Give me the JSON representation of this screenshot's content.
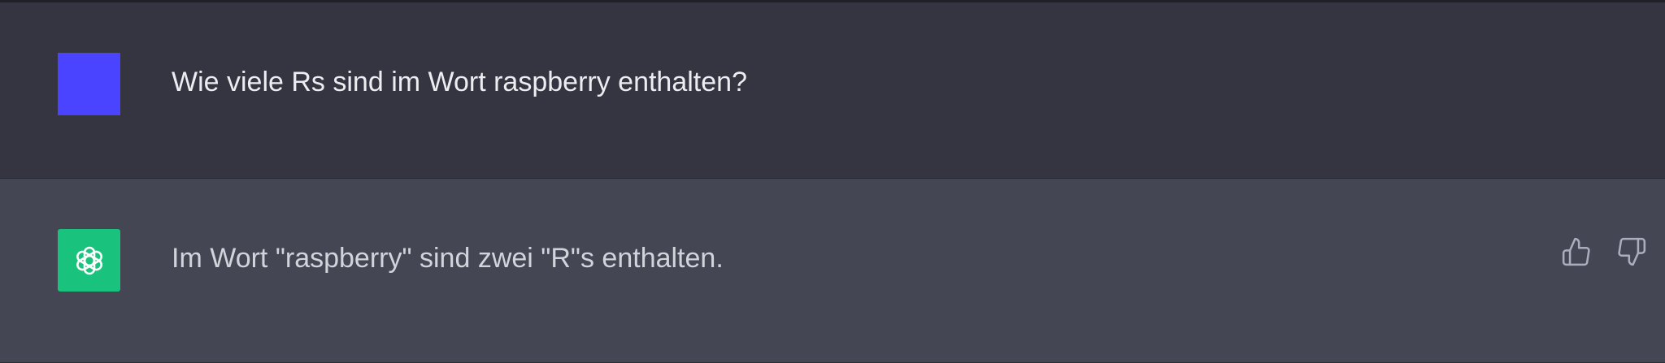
{
  "conversation": {
    "user_message": {
      "text": "Wie viele Rs sind im Wort raspberry enthalten?",
      "avatar_color": "#4a43ff"
    },
    "assistant_message": {
      "text": "Im Wort \"raspberry\" sind zwei \"R\"s enthalten.",
      "avatar_color": "#19c37d",
      "avatar_icon": "openai-logo-icon"
    },
    "actions": [
      {
        "icon": "thumbs-up-icon"
      },
      {
        "icon": "thumbs-down-icon"
      }
    ]
  },
  "colors": {
    "user_row_bg": "#343541",
    "assistant_row_bg": "#444654",
    "text": "#ececf1",
    "icon": "#acacbe"
  }
}
